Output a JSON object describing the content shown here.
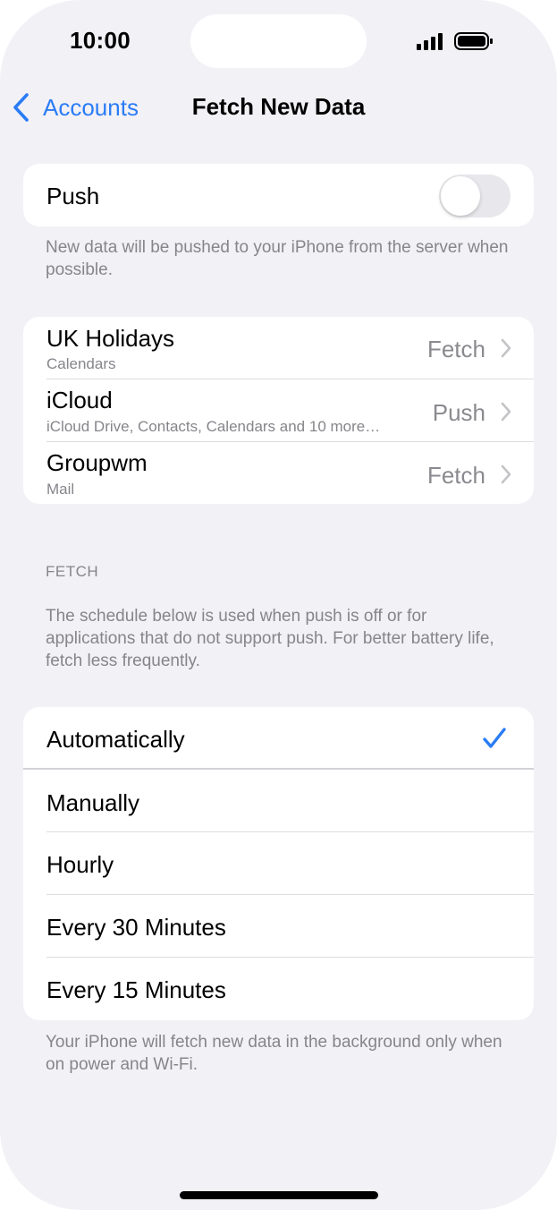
{
  "status": {
    "time": "10:00"
  },
  "nav": {
    "back_label": "Accounts",
    "title": "Fetch New Data"
  },
  "push": {
    "label": "Push",
    "enabled": false,
    "footnote": "New data will be pushed to your iPhone from the server when possible."
  },
  "accounts": [
    {
      "name": "UK Holidays",
      "detail": "Calendars",
      "value": "Fetch"
    },
    {
      "name": "iCloud",
      "detail": "iCloud Drive, Contacts, Calendars and 10 more…",
      "value": "Push"
    },
    {
      "name": "Groupwm",
      "detail": "Mail",
      "value": "Fetch"
    }
  ],
  "fetch": {
    "header": "FETCH",
    "description": "The schedule below is used when push is off or for applications that do not support push. For better battery life, fetch less frequently.",
    "options": [
      {
        "label": "Automatically",
        "selected": true
      },
      {
        "label": "Manually",
        "selected": false
      },
      {
        "label": "Hourly",
        "selected": false
      },
      {
        "label": "Every 30 Minutes",
        "selected": false
      },
      {
        "label": "Every 15 Minutes",
        "selected": false
      }
    ],
    "footnote": "Your iPhone will fetch new data in the background only when on power and Wi-Fi."
  },
  "colors": {
    "accent": "#2a7cf5",
    "background": "#f2f1f6",
    "secondary_text": "#85858b"
  }
}
